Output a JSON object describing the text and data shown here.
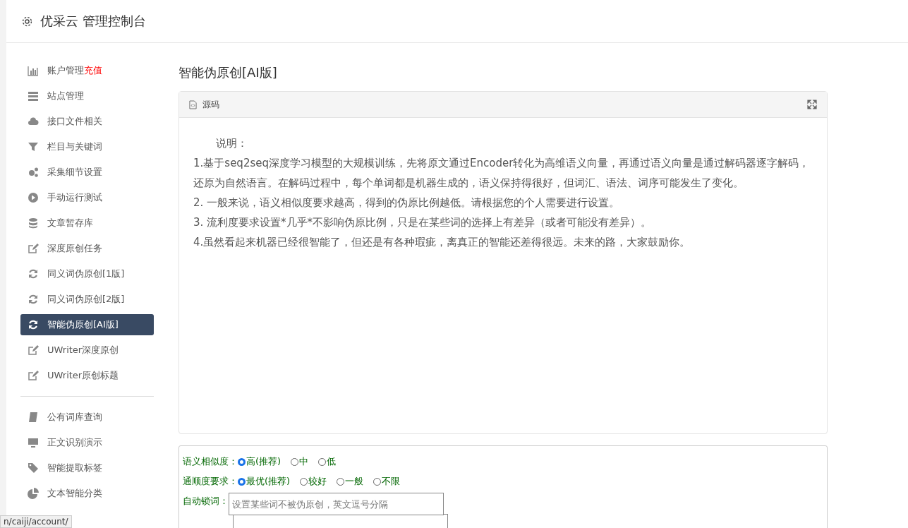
{
  "header": {
    "title": "优采云 管理控制台"
  },
  "sidebar": {
    "groups": [
      {
        "items": [
          {
            "label": "账户管理",
            "badge": "充值",
            "selected": false
          },
          {
            "label": "站点管理",
            "selected": false
          },
          {
            "label": "接口文件相关",
            "selected": false
          },
          {
            "label": "栏目与关键词",
            "selected": false
          },
          {
            "label": "采集细节设置",
            "selected": false
          },
          {
            "label": "手动运行测试",
            "selected": false
          },
          {
            "label": "文章暂存库",
            "selected": false
          },
          {
            "label": "深度原创任务",
            "selected": false
          },
          {
            "label": "同义词伪原创[1版]",
            "selected": false
          },
          {
            "label": "同义词伪原创[2版]",
            "selected": false
          },
          {
            "label": "智能伪原创[AI版]",
            "selected": true
          },
          {
            "label": "UWriter深度原创",
            "selected": false
          },
          {
            "label": "UWriter原创标题",
            "selected": false
          }
        ]
      },
      {
        "items": [
          {
            "label": "公有词库查询",
            "selected": false
          },
          {
            "label": "正文识别演示",
            "selected": false
          },
          {
            "label": "智能提取标签",
            "selected": false
          },
          {
            "label": "文本智能分类",
            "selected": false
          }
        ]
      }
    ]
  },
  "page_title": "智能伪原创[AI版]",
  "source_panel": {
    "title": "源码",
    "intro": "说明：",
    "paragraphs": [
      "1.基于seq2seq深度学习模型的大规模训练，先将原文通过Encoder转化为高维语义向量，再通过语义向量是通过解码器逐字解码，还原为自然语言。在解码过程中，每个单词都是机器生成的，语义保持得很好，但词汇、语法、词序可能发生了变化。",
      "2. 一般来说，语义相似度要求越高，得到的伪原比例越低。请根据您的个人需要进行设置。",
      "3. 流利度要求设置*几乎*不影响伪原比例，只是在某些词的选择上有差异（或者可能没有差异）。",
      "4.虽然看起来机器已经很智能了，但还是有各种瑕疵，离真正的智能还差得很远。未来的路，大家鼓励你。"
    ]
  },
  "options": [
    {
      "label": "语义相似度：",
      "choices": [
        {
          "label": "高(推荐)",
          "selected": true
        },
        {
          "label": "中",
          "selected": false
        },
        {
          "label": "低",
          "selected": false
        }
      ]
    },
    {
      "label": "通顺度要求：",
      "choices": [
        {
          "label": "最优(推荐)",
          "selected": true
        },
        {
          "label": "较好",
          "selected": false
        },
        {
          "label": "一般",
          "selected": false
        },
        {
          "label": "不限",
          "selected": false
        }
      ]
    }
  ],
  "lock_words": {
    "label": "自动锁词：",
    "placeholder": "设置某些词不被伪原创，英文逗号分隔"
  },
  "status_url": "n/caiji/account/"
}
